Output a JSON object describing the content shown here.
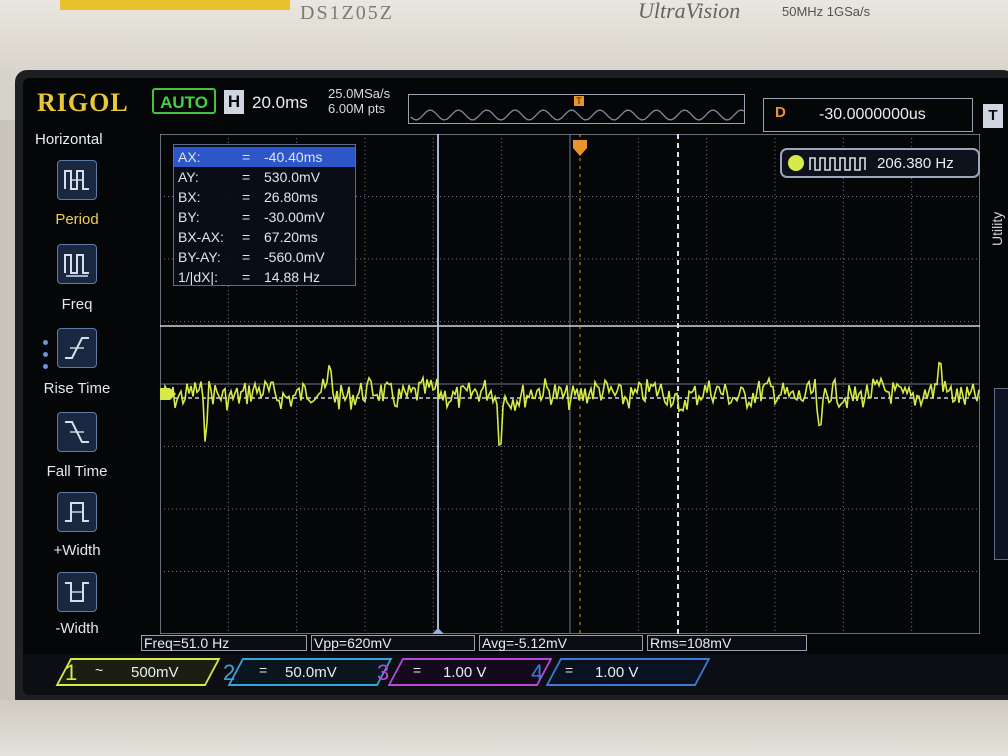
{
  "bezel": {
    "model": "DS1Z05Z",
    "series": "UltraVision",
    "bandwidth": "50MHz 1GSa/s"
  },
  "topbar": {
    "logo": "RIGOL",
    "mode": "AUTO",
    "h_badge": "H",
    "timebase": "20.0ms",
    "sample_rate": "25.0MSa/s",
    "mem_depth": "6.00M pts",
    "trig_pos_badge": "T",
    "delay_label": "D",
    "delay_value": "-30.0000000us",
    "trigger_badge": "T"
  },
  "menu": {
    "title": "Horizontal",
    "items": [
      {
        "label": "Period",
        "icon": "period-icon",
        "selected": true
      },
      {
        "label": "Freq",
        "icon": "freq-icon",
        "selected": false
      },
      {
        "label": "Rise Time",
        "icon": "rise-time-icon",
        "selected": false
      },
      {
        "label": "Fall Time",
        "icon": "fall-time-icon",
        "selected": false
      },
      {
        "label": "+Width",
        "icon": "pos-width-icon",
        "selected": false
      },
      {
        "label": "-Width",
        "icon": "neg-width-icon",
        "selected": false
      }
    ]
  },
  "cursors": [
    {
      "key": "AX:",
      "value": "-40.40ms"
    },
    {
      "key": "AY:",
      "value": "530.0mV"
    },
    {
      "key": "BX:",
      "value": "26.80ms"
    },
    {
      "key": "BY:",
      "value": "-30.00mV"
    },
    {
      "key": "BX-AX:",
      "value": "67.20ms"
    },
    {
      "key": "BY-AY:",
      "value": "-560.0mV"
    },
    {
      "key": "1/|dX|:",
      "value": "14.88 Hz"
    }
  ],
  "cursor_eq": "=",
  "freq_counter": {
    "channel": "1",
    "value": "206.380 Hz"
  },
  "side_menu": {
    "utility": "Utility"
  },
  "ch1_marker": "1",
  "measurements": [
    {
      "label": "Freq=51.0 Hz"
    },
    {
      "label": "Vpp=620mV"
    },
    {
      "label": "Avg=-5.12mV"
    },
    {
      "label": "Rms=108mV"
    }
  ],
  "channels": [
    {
      "num": "1",
      "coupling": "~",
      "scale": "500mV",
      "color": "#d7ea47"
    },
    {
      "num": "2",
      "coupling": "=",
      "scale": "50.0mV",
      "color": "#39a4d9"
    },
    {
      "num": "3",
      "coupling": "=",
      "scale": "1.00 V",
      "color": "#b54ad8"
    },
    {
      "num": "4",
      "coupling": "=",
      "scale": "1.00 V",
      "color": "#3b7bd6"
    }
  ],
  "colors": {
    "trace": "#d7ea47",
    "logo": "#e8c838",
    "accent_orange": "#e8952e",
    "grid": "#6f7686"
  }
}
